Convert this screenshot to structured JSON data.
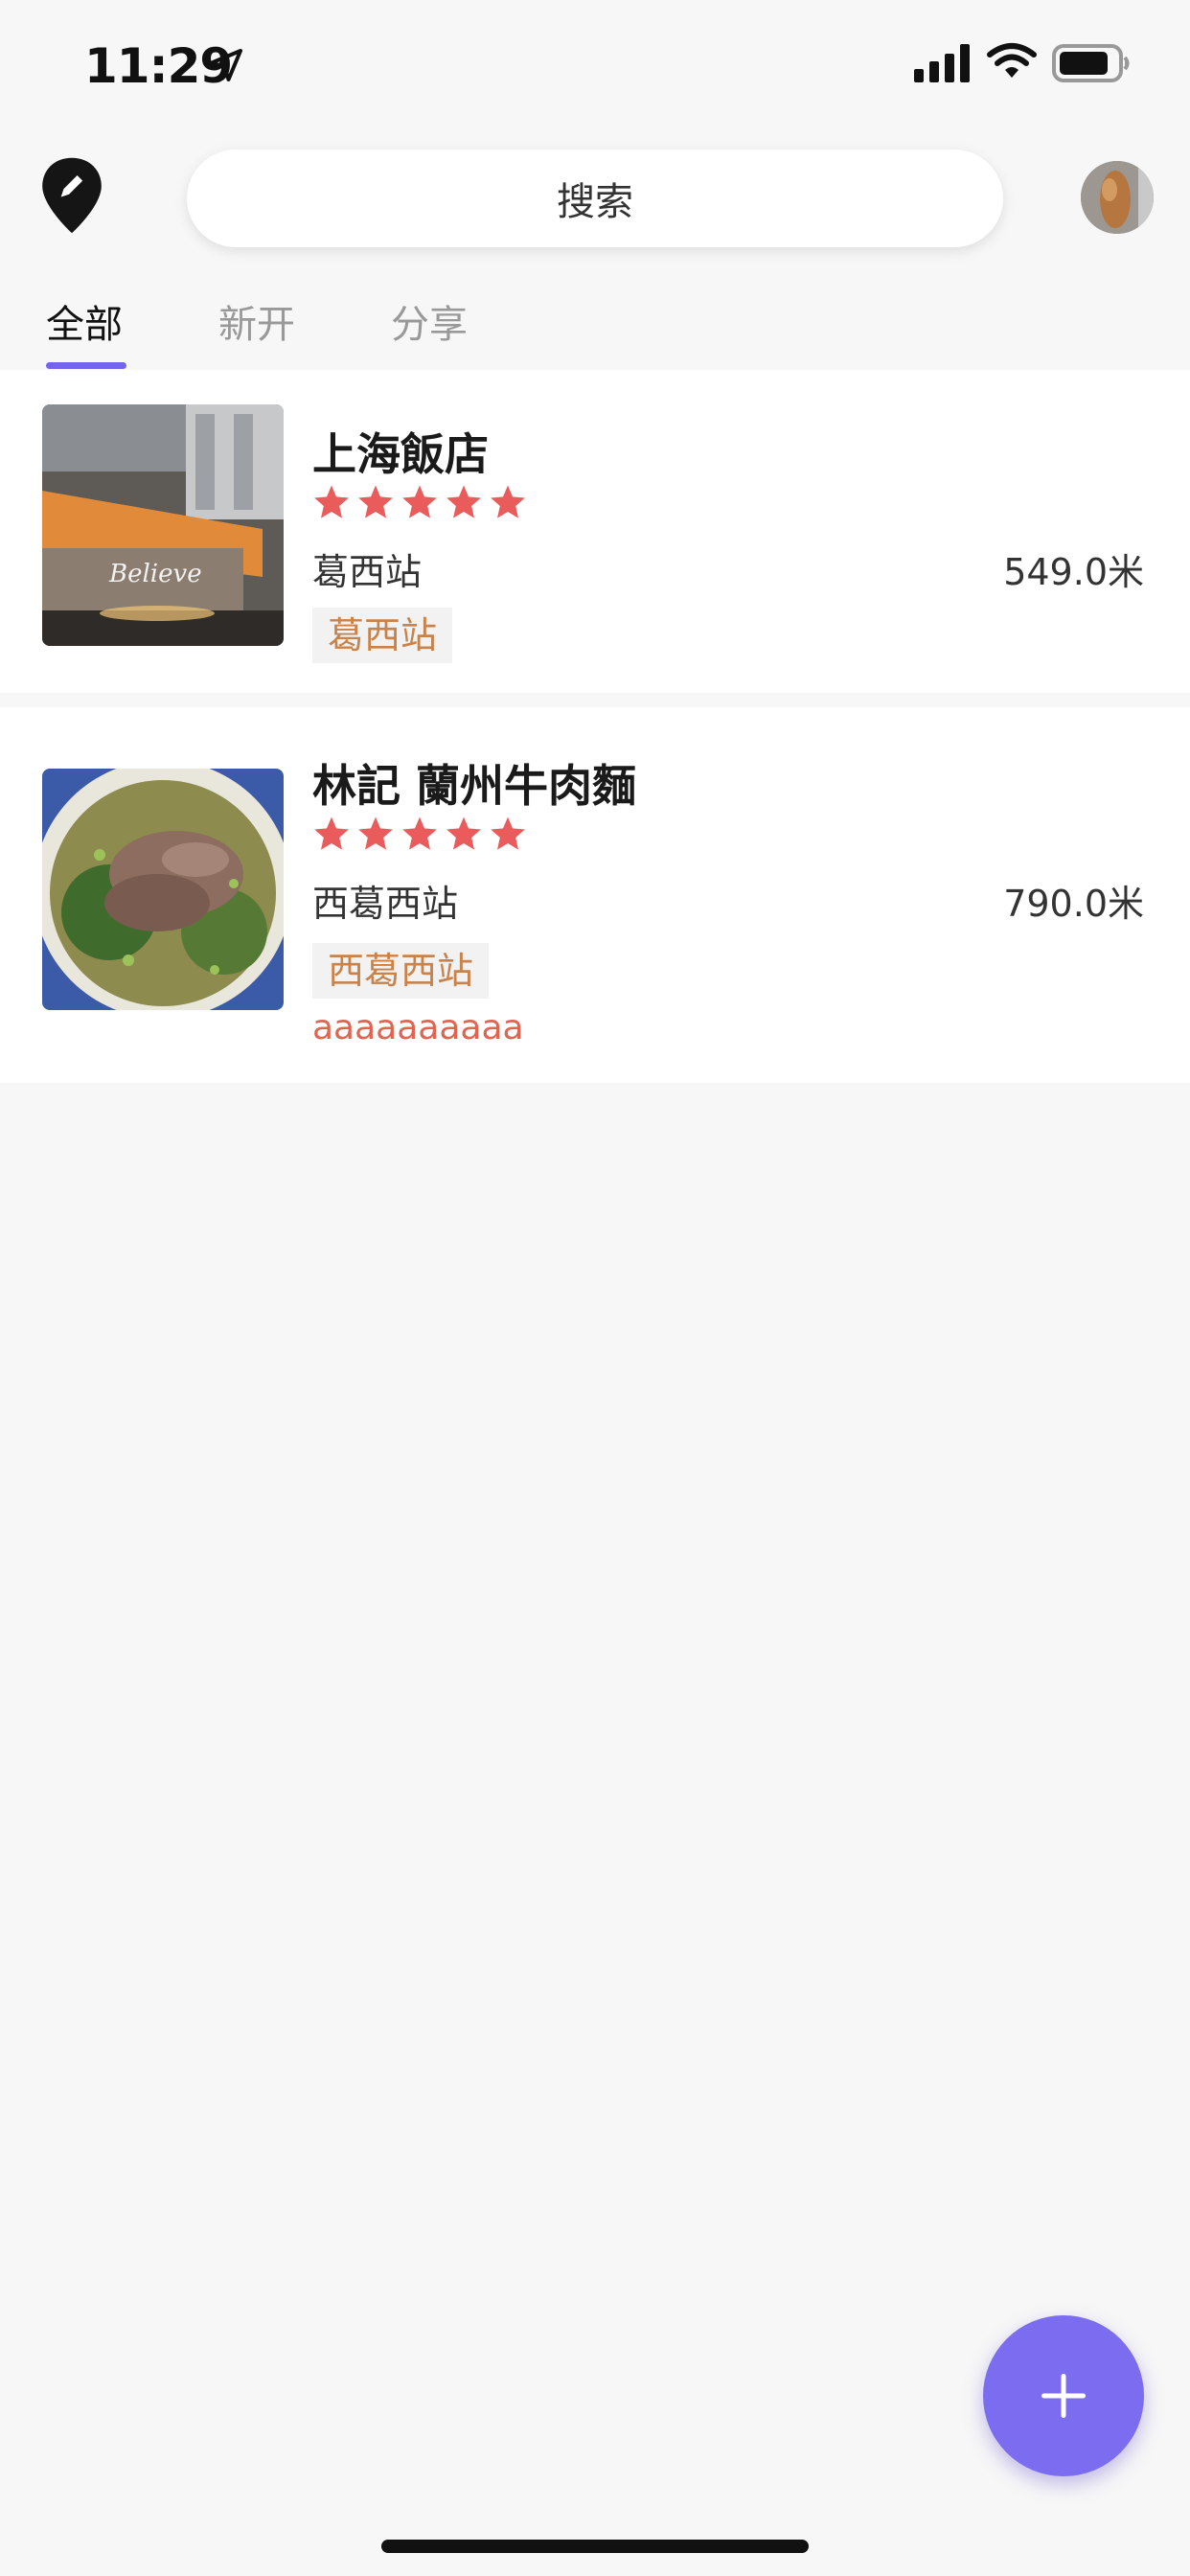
{
  "status_bar": {
    "time": "11:29"
  },
  "header": {
    "search_placeholder": "搜索"
  },
  "tabs": [
    {
      "label": "全部",
      "active": true
    },
    {
      "label": "新开",
      "active": false
    },
    {
      "label": "分享",
      "active": false
    }
  ],
  "restaurants": [
    {
      "name": "上海飯店",
      "rating": 5,
      "station": "葛西站",
      "distance": "549.0米",
      "tag": "葛西站",
      "note": ""
    },
    {
      "name": "林記 蘭州牛肉麵",
      "rating": 5,
      "station": "西葛西站",
      "distance": "790.0米",
      "tag": "西葛西站",
      "note": "aaaaaaaaaa"
    }
  ],
  "colors": {
    "accent": "#7464ec",
    "star": "#ea5b5b",
    "tag_text": "#c8824a",
    "note_text": "#e06452"
  },
  "icons": {
    "header_left": "pin-edit-icon",
    "fab": "plus-icon"
  }
}
